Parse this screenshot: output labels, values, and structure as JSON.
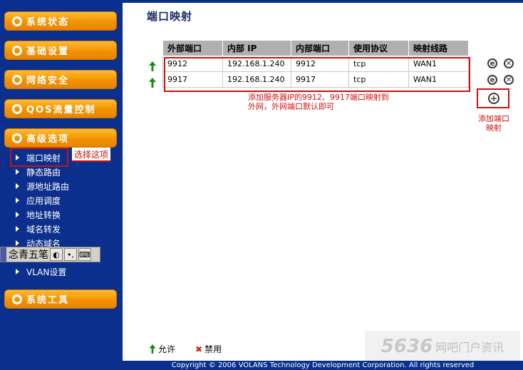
{
  "sidebar": {
    "sections": [
      {
        "label": "系统状态"
      },
      {
        "label": "基础设置"
      },
      {
        "label": "网络安全"
      },
      {
        "label": "QOS流量控制"
      },
      {
        "label": "高级选项"
      },
      {
        "label": "系统工具"
      }
    ],
    "sub_items": [
      {
        "label": "端口映射"
      },
      {
        "label": "静态路由"
      },
      {
        "label": "源地址路由"
      },
      {
        "label": "应用调度"
      },
      {
        "label": "地址转换"
      },
      {
        "label": "域名转发"
      },
      {
        "label": "动态域名"
      },
      {
        "label": "VLAN设置"
      }
    ],
    "selected_note": "选择这项"
  },
  "ime_toolbar": {
    "text": "念青五笔"
  },
  "main": {
    "title": "端口映射",
    "table": {
      "headers": [
        "外部端口",
        "内部 IP",
        "内部端口",
        "使用协议",
        "映射线路"
      ],
      "rows": [
        [
          "9912",
          "192.168.1.240",
          "9912",
          "tcp",
          "WAN1"
        ],
        [
          "9917",
          "192.168.1.240",
          "9917",
          "tcp",
          "WAN1"
        ]
      ]
    },
    "annotation": "添加服务器IP的9912、9917端口映射到外网，外网端口默认即可",
    "add_note": "添加端口映射",
    "legend": {
      "allow": "允许",
      "deny": "禁用"
    },
    "footer": "Copyright © 2006 VOLANS Technology Development Corporation. All rights reserved",
    "watermark": {
      "number": "5636",
      "text": "网吧门户资讯"
    }
  },
  "colors": {
    "sidebar_bg": "#0b2f8c",
    "button_orange": "#f29200",
    "annotation_red": "#cc1111",
    "allow_green": "#1a8a1a",
    "deny_red": "#dd2211"
  }
}
